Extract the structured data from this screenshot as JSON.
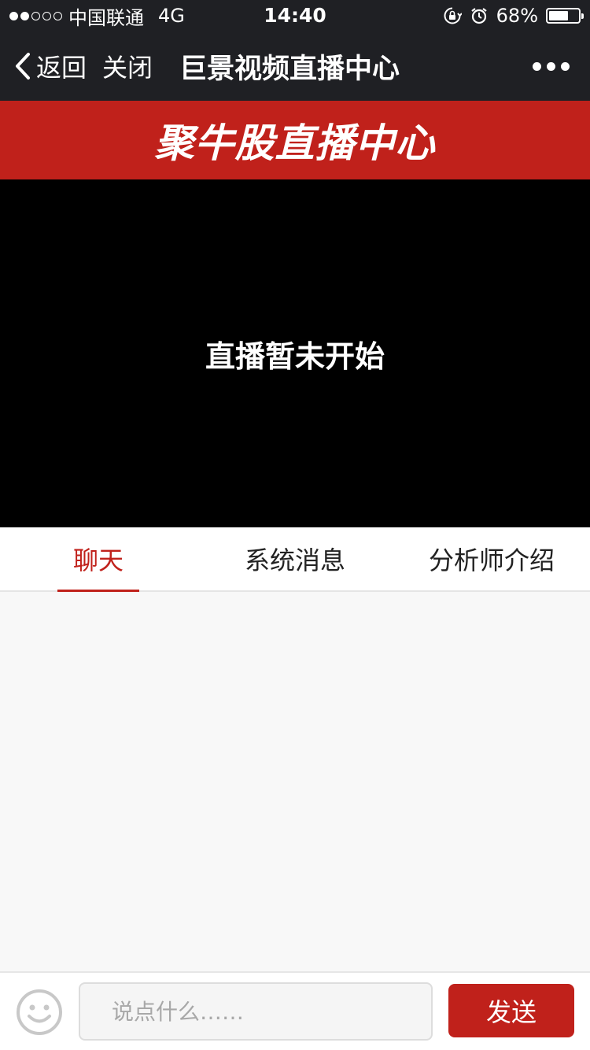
{
  "status_bar": {
    "carrier": "中国联通",
    "network": "4G",
    "time": "14:40",
    "battery": "68%",
    "battery_level": 0.68,
    "signal_bars_filled": 2,
    "signal_bars_total": 5
  },
  "nav": {
    "back_label": "返回",
    "close_label": "关闭",
    "title": "巨景视频直播中心"
  },
  "banner": {
    "title": "聚牛股直播中心"
  },
  "video": {
    "status_text": "直播暂未开始"
  },
  "tabs": [
    {
      "label": "聊天",
      "active": true
    },
    {
      "label": "系统消息",
      "active": false
    },
    {
      "label": "分析师介绍",
      "active": false
    }
  ],
  "composer": {
    "placeholder": "说点什么……",
    "send_label": "发送"
  },
  "colors": {
    "accent": "#c0211b",
    "header_bg": "#1f2024",
    "video_bg": "#000000",
    "chat_bg": "#f8f8f8"
  }
}
